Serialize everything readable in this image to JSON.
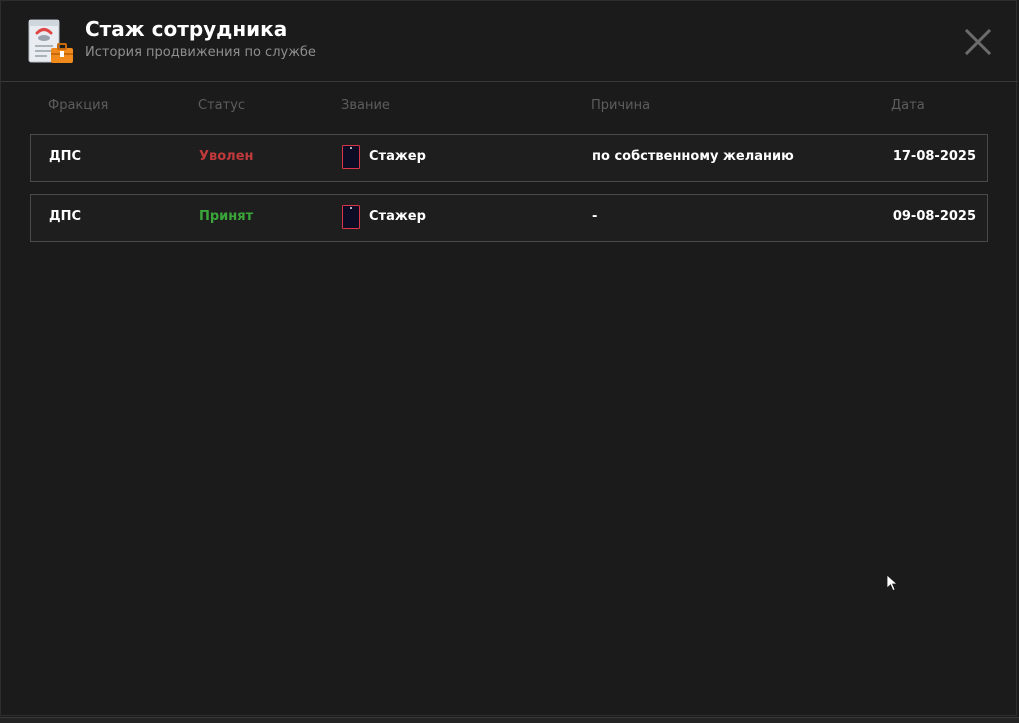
{
  "window": {
    "title": "Стаж сотрудника",
    "subtitle": "История продвижения по службе"
  },
  "icons": {
    "header": "employment-record-icon",
    "close": "close-icon",
    "rank": "rank-insignia-icon",
    "cursor": "mouse-cursor-icon"
  },
  "table": {
    "headers": {
      "faction": "Фракция",
      "status": "Статус",
      "rank": "Звание",
      "reason": "Причина",
      "date": "Дата"
    },
    "rows": [
      {
        "faction": "ДПС",
        "status": "Уволен",
        "status_color": "#c0393b",
        "rank": "Стажер",
        "reason": "по собственному желанию",
        "date": "17-08-2025"
      },
      {
        "faction": "ДПС",
        "status": "Принят",
        "status_color": "#3aa63a",
        "rank": "Стажер",
        "reason": "-",
        "date": "09-08-2025"
      }
    ]
  },
  "colors": {
    "background": "#1b1b1b",
    "row_border": "#4a4a4a",
    "header_text": "#5d5d5d",
    "accent_orange": "#f08a1c"
  }
}
